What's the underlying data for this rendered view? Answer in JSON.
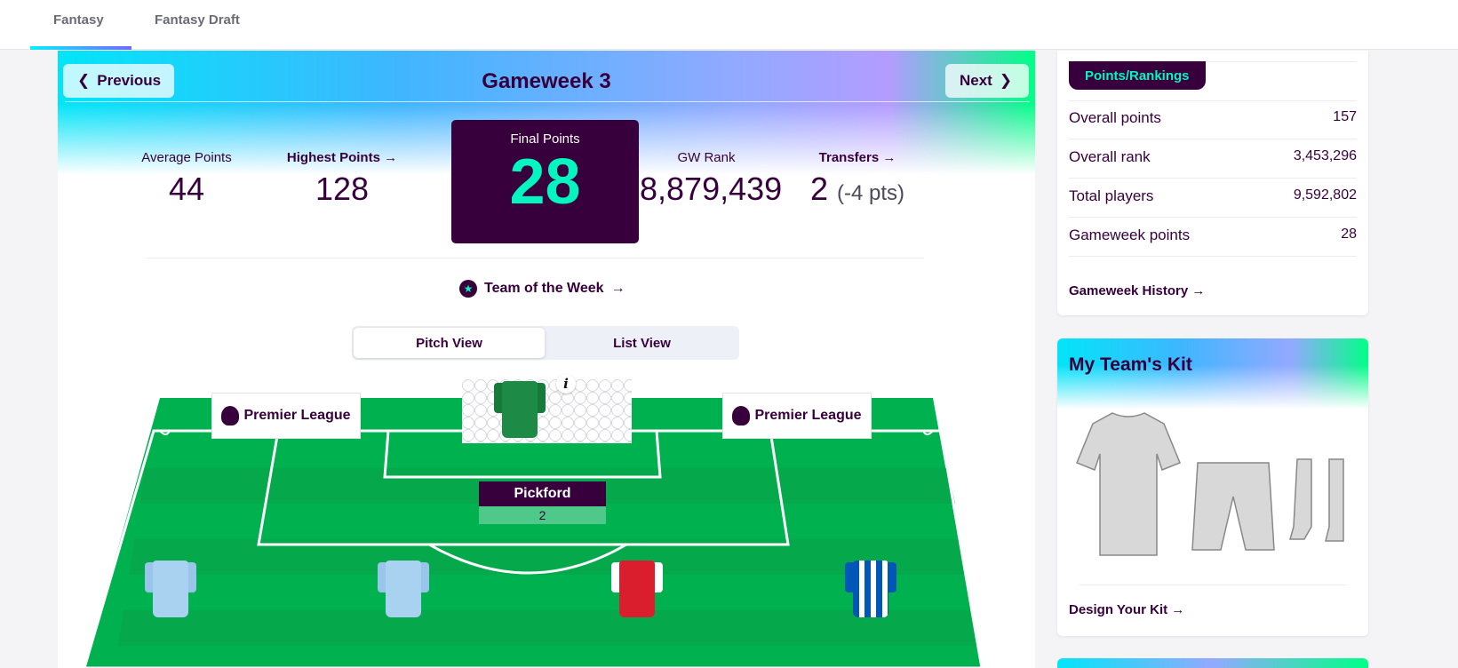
{
  "nav": {
    "tabs": [
      "Fantasy",
      "Fantasy Draft"
    ]
  },
  "gameweek": {
    "prev_label": "Previous",
    "next_label": "Next",
    "title": "Gameweek 3",
    "average_label": "Average Points",
    "average_value": "44",
    "highest_label": "Highest Points",
    "highest_value": "128",
    "final_label": "Final Points",
    "final_value": "28",
    "rank_label": "GW Rank",
    "rank_value": "8,879,439",
    "transfers_label": "Transfers",
    "transfers_value": "2",
    "transfers_cost": "(-4 pts)",
    "totw_label": "Team of the Week",
    "pitch_view": "Pitch View",
    "list_view": "List View"
  },
  "pitch": {
    "board_left": "Premier League",
    "board_right": "Premier League",
    "goalkeeper": {
      "name": "Pickford",
      "points": "2"
    },
    "info_glyph": "i"
  },
  "sidebar": {
    "tab_label": "Points/Rankings",
    "rows": [
      {
        "label": "Overall points",
        "value": "157"
      },
      {
        "label": "Overall rank",
        "value": "3,453,296"
      },
      {
        "label": "Total players",
        "value": "9,592,802"
      },
      {
        "label": "Gameweek points",
        "value": "28"
      }
    ],
    "history_label": "Gameweek History →",
    "kit_title": "My Team's Kit",
    "kit_link": "Design Your Kit →"
  },
  "colors": {
    "brand": "#37003c",
    "accent": "#04f5c0",
    "pitch": "#00b14f"
  }
}
